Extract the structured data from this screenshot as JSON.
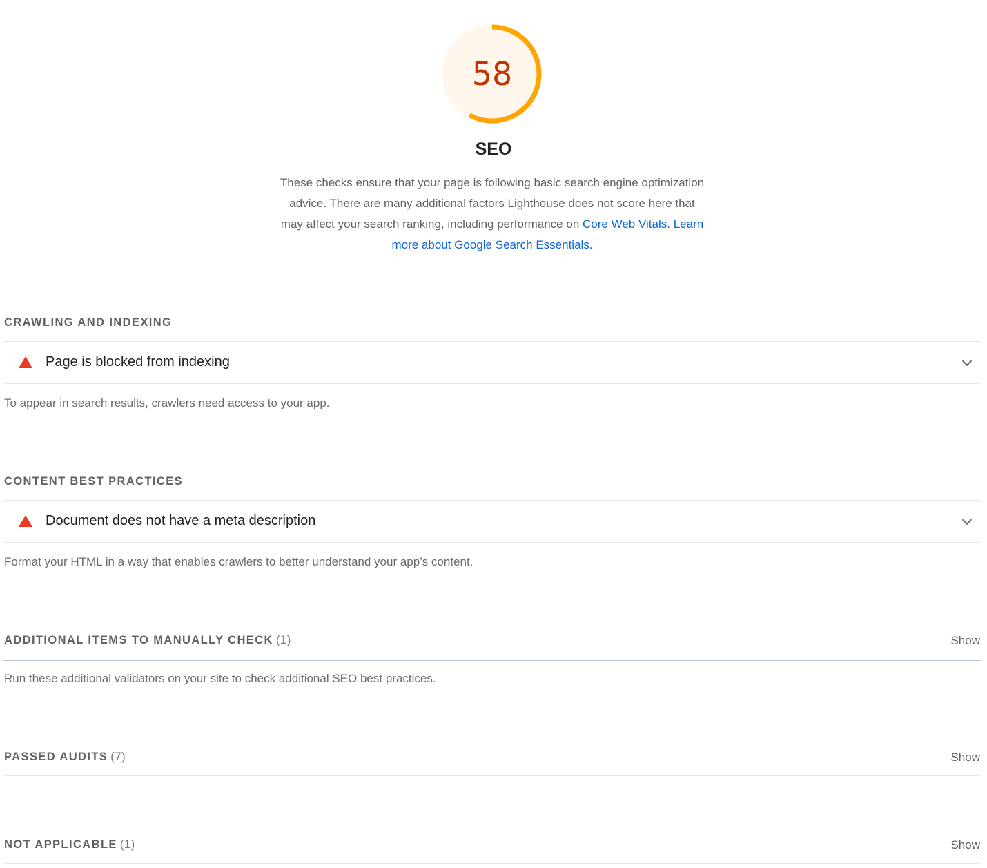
{
  "score": {
    "value": 58,
    "fraction": 0.58,
    "ring_color": "#ffa400",
    "bg_color": "#fff7eb",
    "text_color": "#c33300"
  },
  "category": {
    "title": "SEO",
    "description": "These checks ensure that your page is following basic search engine optimization advice. There are many additional factors Lighthouse does not score here that may affect your search ranking, including performance on",
    "link1": "Core Web Vitals",
    "link2": "Learn more about Google Search Essentials"
  },
  "groups": {
    "crawling": {
      "title": "Crawling and Indexing",
      "audit_title": "Page is blocked from indexing",
      "description": "To appear in search results, crawlers need access to your app."
    },
    "content": {
      "title": "Content Best Practices",
      "audit_title": "Document does not have a meta description",
      "description": "Format your HTML in a way that enables crawlers to better understand your app’s content."
    },
    "manual": {
      "title": "Additional items to manually check",
      "count": "(1)",
      "show_label": "Show",
      "description": "Run these additional validators on your site to check additional SEO best practices."
    },
    "passed": {
      "title": "Passed audits",
      "count": "(7)",
      "show_label": "Show"
    },
    "notapplicable": {
      "title": "Not applicable",
      "count": "(1)",
      "show_label": "Show"
    }
  },
  "icons": {
    "fail": "warning-triangle-icon",
    "expand": "chevron-down-icon"
  }
}
